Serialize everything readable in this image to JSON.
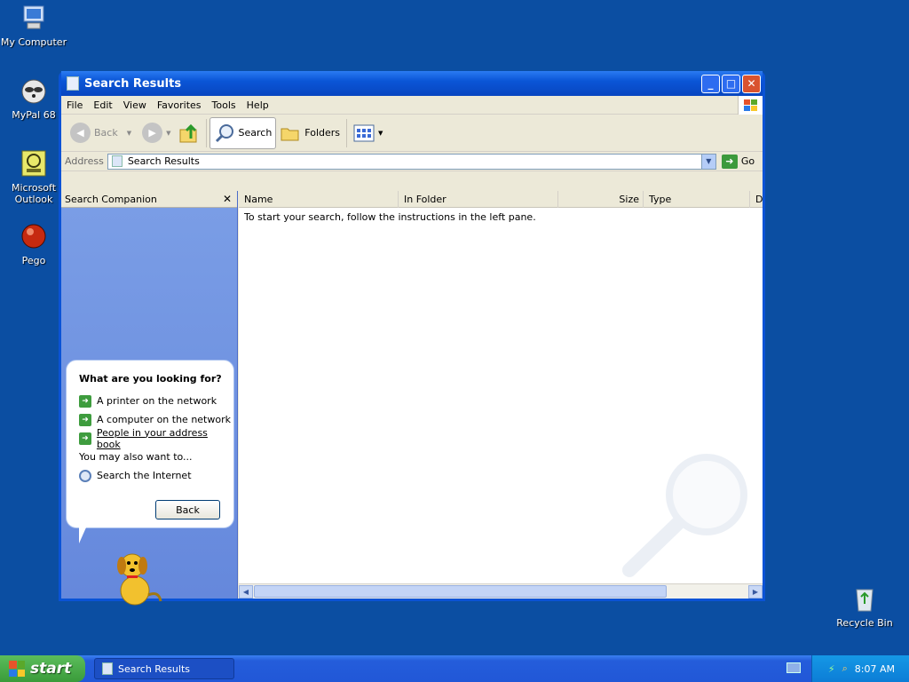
{
  "desktop": {
    "icons": [
      {
        "label": "My Computer",
        "icon": "my-computer-icon"
      },
      {
        "label": "MyPal 68",
        "icon": "raccoon-icon"
      },
      {
        "label": "Microsoft Outlook",
        "icon": "outlook-icon"
      },
      {
        "label": "Pego",
        "icon": "pego-icon"
      },
      {
        "label": "Recycle Bin",
        "icon": "recycle-bin-icon"
      }
    ]
  },
  "window": {
    "title": "Search Results",
    "menu": [
      "File",
      "Edit",
      "View",
      "Favorites",
      "Tools",
      "Help"
    ],
    "toolbar": {
      "back": "Back",
      "search": "Search",
      "folders": "Folders"
    },
    "address": {
      "label": "Address",
      "value": "Search Results",
      "go": "Go"
    },
    "companion": {
      "header": "Search Companion",
      "close": "✕",
      "question": "What are you looking for?",
      "options": [
        "A printer on the network",
        "A computer on the network",
        "People in your address book"
      ],
      "also": "You may also want to...",
      "search_internet": "Search the Internet",
      "back_button": "Back"
    },
    "columns": [
      "Name",
      "In Folder",
      "Size",
      "Type",
      "D"
    ],
    "message": "To start your search, follow the instructions in the left pane."
  },
  "taskbar": {
    "start": "start",
    "task": "Search Results",
    "time": "8:07 AM"
  },
  "colors": {
    "desktop": "#0b4ea2",
    "titlebar": "#0a55d6",
    "companion_pane": "#7b9ee6",
    "start_green": "#3a9b3a"
  }
}
